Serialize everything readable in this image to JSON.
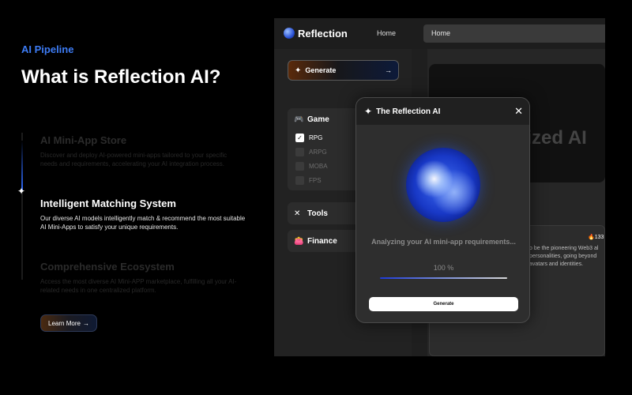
{
  "marketing": {
    "eyebrow": "AI Pipeline",
    "headline": "What is Reflection AI?",
    "features": [
      {
        "title": "AI Mini-App Store",
        "desc": "Discover and deploy AI-powered mini-apps tailored to your specific needs and requirements, accelerating your AI integration process."
      },
      {
        "title": "Intelligent Matching System",
        "desc": "Our diverse AI models intelligently match & recommend the most suitable AI Mini-Apps to satisfy your unique requirements."
      },
      {
        "title": "Comprehensive Ecosystem",
        "desc": "Access the most diverse AI Mini-APP marketplace, fulfilling all your AI-related needs in one centralized platform."
      }
    ],
    "learn_more": "Learn More",
    "learn_more_icon": "→"
  },
  "app": {
    "brand": "Reflection",
    "nav_home": "Home",
    "address": "Home",
    "sidebar": {
      "generate_label": "Generate",
      "generate_icon": "✦",
      "generate_arrow": "→",
      "categories": {
        "game": {
          "label": "Game",
          "icon": "🎮",
          "options": [
            {
              "label": "RPG",
              "checked": true
            },
            {
              "label": "ARPG",
              "checked": false
            },
            {
              "label": "MOBA",
              "checked": false
            },
            {
              "label": "FPS",
              "checked": false
            }
          ]
        },
        "tools": {
          "label": "Tools",
          "icon": "✕"
        },
        "finance": {
          "label": "Finance",
          "icon": "👛"
        }
      }
    },
    "hero_title": "Decentralized AI personal",
    "info_card": {
      "text": "o be the pioneering Web3 al personalities, going beyond avatars and identities.",
      "likes": "🔥133"
    }
  },
  "modal": {
    "title": "The Reflection AI",
    "title_icon": "✦",
    "close_icon": "✕",
    "status": "Analyzing your AI mini-app requirements...",
    "percent": "100 %",
    "progress": 1.0,
    "button": "Generate"
  },
  "colors": {
    "accent_blue": "#3d7cf5",
    "background": "#000000",
    "panel": "#262626"
  }
}
